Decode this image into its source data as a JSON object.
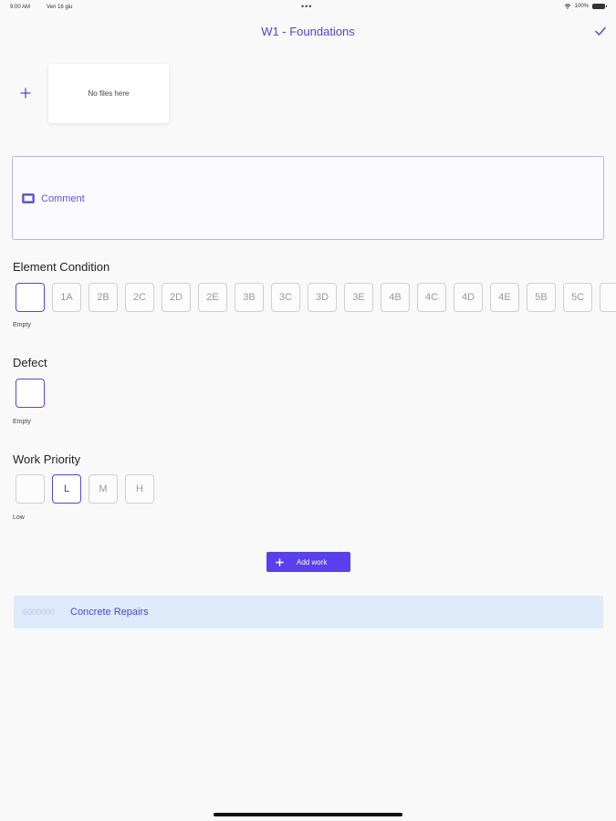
{
  "status_bar": {
    "time": "9:00 AM",
    "date": "Ven 16 giu",
    "dots": "•••",
    "battery_text": "100%"
  },
  "header": {
    "title": "W1 - Foundations"
  },
  "files": {
    "empty_text": "No files here"
  },
  "comment": {
    "label": "Comment"
  },
  "element_condition": {
    "title": "Element Condition",
    "options": [
      "",
      "1A",
      "2B",
      "2C",
      "2D",
      "2E",
      "3B",
      "3C",
      "3D",
      "3E",
      "4B",
      "4C",
      "4D",
      "4E",
      "5B",
      "5C",
      ""
    ],
    "selected_caption": "Empty"
  },
  "defect": {
    "title": "Defect",
    "selected_caption": "Empty"
  },
  "work_priority": {
    "title": "Work Priority",
    "options": [
      "",
      "L",
      "M",
      "H"
    ],
    "selected_caption": "Low"
  },
  "actions": {
    "add_work_label": "Add work"
  },
  "work_items": [
    {
      "code": "6000000",
      "name": "Concrete Repairs"
    }
  ],
  "colors": {
    "accent": "#4c45d8",
    "button": "#5a3ff0",
    "work_item_bg": "#ddebfb"
  }
}
